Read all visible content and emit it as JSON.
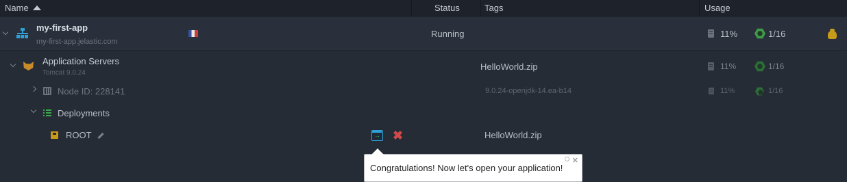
{
  "header": {
    "name": "Name",
    "status": "Status",
    "tags": "Tags",
    "usage": "Usage"
  },
  "environment": {
    "name": "my-first-app",
    "domain": "my-first-app.jelastic.com",
    "status": "Running",
    "disk": "11%",
    "cloudlets": "1/16",
    "icons": {
      "env": "topology-tree-icon",
      "region": "france-flag-icon",
      "billing": "money-bag-icon",
      "disk": "disk-icon",
      "cloudlets": "cloudlet-hex-icon"
    }
  },
  "app_servers": {
    "title": "Application Servers",
    "subtitle": "Tomcat 9.0.24",
    "tag": "HelloWorld.zip",
    "disk": "11%",
    "cloudlets": "1/16"
  },
  "node": {
    "label": "Node ID: 228141",
    "tag": "9.0.24-openjdk-14.ea-b14",
    "disk": "11%",
    "cloudlets": "1/16"
  },
  "deployments": {
    "label": "Deployments"
  },
  "root": {
    "label": "ROOT",
    "tag": "HelloWorld.zip"
  },
  "tooltip": {
    "text": "Congratulations! Now let's open your application!"
  },
  "colors": {
    "background": "#242a34",
    "accent_blue": "#2f9fd6",
    "accent_green": "#3f9a4a",
    "danger": "#d14a4a",
    "gold": "#c79a1a"
  }
}
